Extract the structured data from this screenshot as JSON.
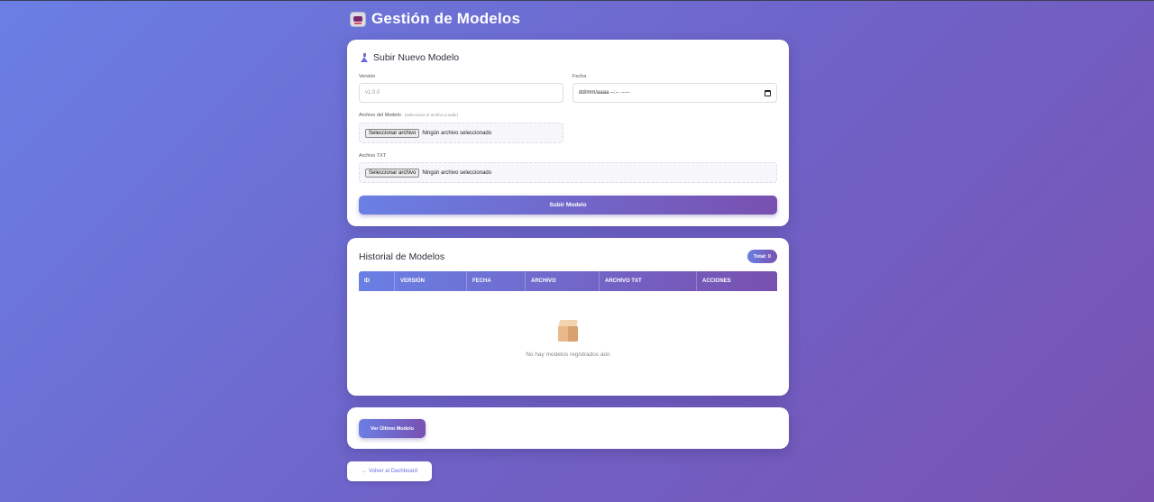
{
  "header": {
    "title": "Gestión de Modelos",
    "icon": "robot-icon"
  },
  "upload": {
    "title": "Subir Nuevo Modelo",
    "icon": "flask-icon",
    "version_label": "Versión",
    "version_placeholder": "v1.0.0",
    "date_label": "Fecha",
    "date_value": "dd/mm/aaaa --:-- -----",
    "model_file_label": "Archivo del Modelo",
    "model_file_hint": "(selecciona el archivo a subir)",
    "txt_file_label": "Archivo TXT",
    "file_button": "Seleccionar archivo",
    "no_file": "Ningún archivo seleccionado",
    "submit_label": "Subir Modelo"
  },
  "history": {
    "title": "Historial de Modelos",
    "total_badge": "Total: 0",
    "columns": [
      "ID",
      "VERSIÓN",
      "FECHA",
      "ARCHIVO",
      "ARCHIVO TXT",
      "ACCIONES"
    ],
    "empty_icon": "box-icon",
    "empty_message": "No hay modelos registrados aún"
  },
  "latest": {
    "button_label": "Ver Último Modelo"
  },
  "back": {
    "arrow": "←",
    "label": "Volver al Dashboard"
  },
  "colors": {
    "gradient_start": "#6a7fe4",
    "gradient_end": "#7850b0",
    "accent": "#6a6ee0"
  }
}
